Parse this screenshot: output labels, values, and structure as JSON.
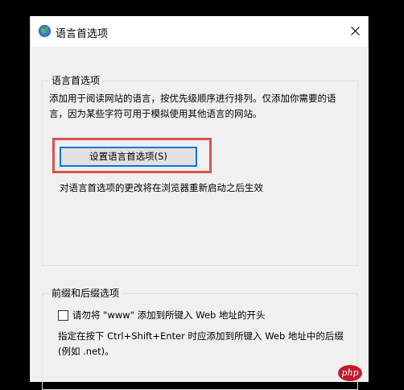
{
  "window": {
    "title": "语言首选项",
    "close_label": "✕"
  },
  "group_language": {
    "legend": "语言首选项",
    "description": "添加用于阅读网站的语言，按优先级顺序进行排列。仅添加你需要的语言，因为某些字符可用于模拟使用其他语言的网站。",
    "button_label": "设置语言首选项(S)",
    "note": "对语言首选项的更改将在浏览器重新启动之后生效"
  },
  "group_prefix_suffix": {
    "legend": "前缀和后缀选项",
    "checkbox_label": "请勿将 \"www\" 添加到所键入 Web 地址的开头",
    "checkbox_checked": false,
    "description": "指定在按下 Ctrl+Shift+Enter 时应添加到所键入 Web 地址中的后缀(例如 .net)。"
  },
  "watermark": {
    "text": "php"
  },
  "colors": {
    "highlight": "#d9534f",
    "button_focus": "#0078d7",
    "background": "#000000"
  }
}
